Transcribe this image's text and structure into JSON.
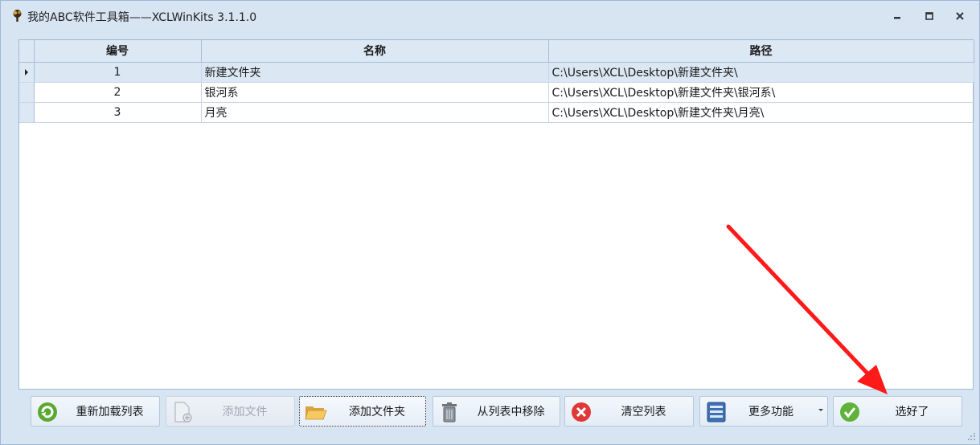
{
  "window": {
    "title": "我的ABC软件工具箱——XCLWinKits  3.1.1.0",
    "controls": [
      "minimize-icon",
      "maximize-icon",
      "close-icon"
    ]
  },
  "grid": {
    "columns": [
      "编号",
      "名称",
      "路径"
    ],
    "rows": [
      {
        "num": "1",
        "name": "新建文件夹",
        "path": "C:\\Users\\XCL\\Desktop\\新建文件夹\\"
      },
      {
        "num": "2",
        "name": "银河系",
        "path": "C:\\Users\\XCL\\Desktop\\新建文件夹\\银河系\\"
      },
      {
        "num": "3",
        "name": "月亮",
        "path": "C:\\Users\\XCL\\Desktop\\新建文件夹\\月亮\\"
      }
    ],
    "selected_row": 0
  },
  "toolbar": {
    "reload": "重新加载列表",
    "add_file": "添加文件",
    "add_folder": "添加文件夹",
    "remove": "从列表中移除",
    "clear": "清空列表",
    "more": "更多功能",
    "done": "选好了"
  },
  "colors": {
    "window_bg": "#d7e4f2",
    "header_bg": "#dde8f5",
    "selected_row_bg": "#dce7f4",
    "annotation_arrow": "#ff1a1a"
  }
}
